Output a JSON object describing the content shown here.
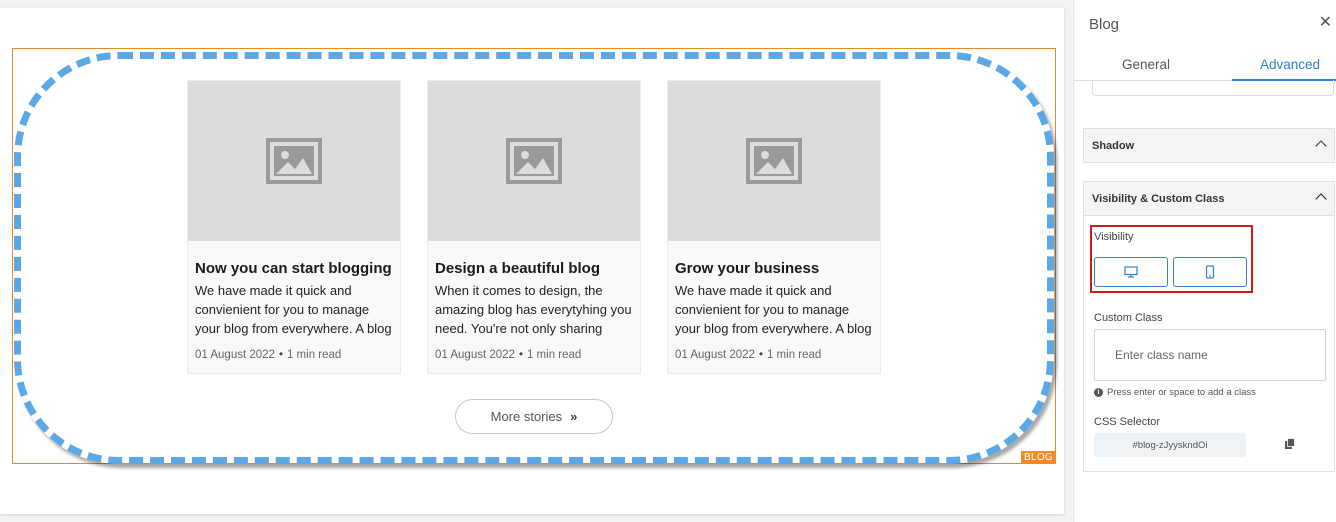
{
  "canvas": {
    "block_tag": "BLOG",
    "posts": [
      {
        "title": "Now you can start blogging",
        "excerpt": "We have made it quick and convienient for you to manage your blog from everywhere. A blog that..",
        "date": "01 August 2022",
        "read_time": "1 min read"
      },
      {
        "title": "Design a beautiful blog",
        "excerpt": "When it comes to design, the amazing blog has everytyhing you need. You're not only sharing your..",
        "date": "01 August 2022",
        "read_time": "1 min read"
      },
      {
        "title": "Grow your business",
        "excerpt": "We have made it quick and convienient for you to manage your blog from everywhere. A blog that..",
        "date": "01 August 2022",
        "read_time": "1 min read"
      }
    ],
    "more_button": "More stories",
    "border_color": "#5aa8e6"
  },
  "panel": {
    "title": "Blog",
    "tabs": [
      "General",
      "Advanced"
    ],
    "active_tab": "Advanced",
    "sections": {
      "shadow": "Shadow",
      "visibility": {
        "header": "Visibility & Custom Class",
        "visibility_label": "Visibility",
        "devices": [
          "desktop-icon",
          "mobile-icon"
        ],
        "custom_class_label": "Custom Class",
        "custom_class_placeholder": "Enter class name",
        "hint": "Press enter or space to add a class",
        "css_selector_label": "CSS Selector",
        "css_selector_value": "#blog-zJyyskndOi"
      }
    },
    "accent": "#2e7fd6",
    "highlight_color": "#d11a1a"
  }
}
